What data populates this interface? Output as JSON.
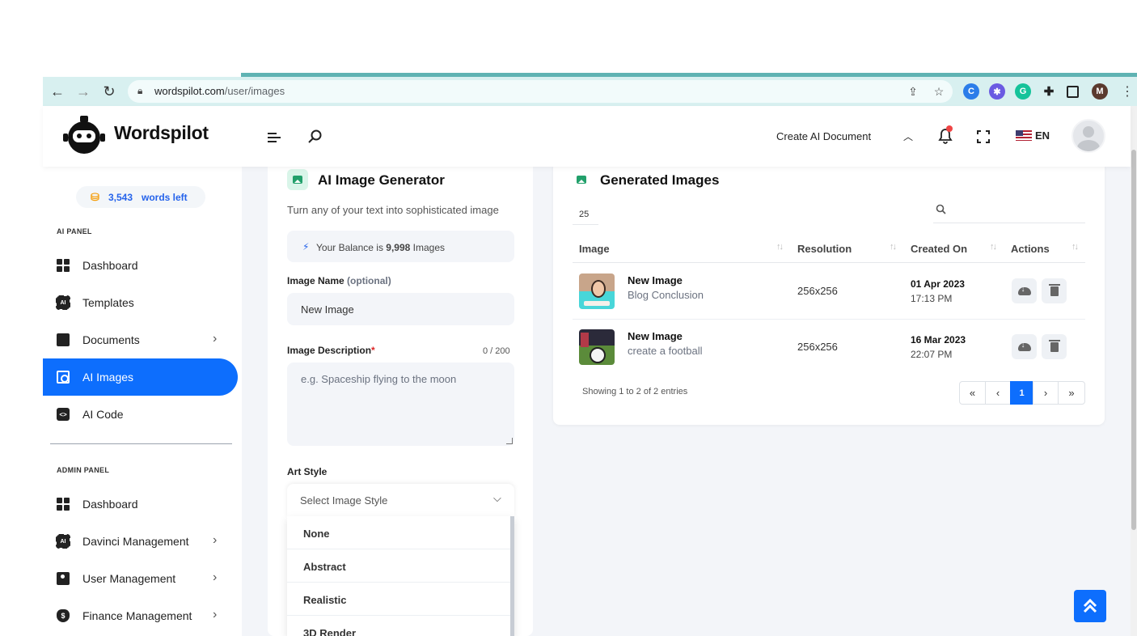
{
  "browser": {
    "url_domain": "wordspilot.com",
    "url_path": "/user/images",
    "profile_initial": "M"
  },
  "header": {
    "brand": "Wordspilot",
    "create_doc": "Create AI Document",
    "language": "EN"
  },
  "sidebar": {
    "words_count": "3,543",
    "words_label": "words left",
    "ai_panel_title": "AI PANEL",
    "ai_items": [
      {
        "label": "Dashboard",
        "icon": "dashboard-icon"
      },
      {
        "label": "Templates",
        "icon": "chip-icon"
      },
      {
        "label": "Documents",
        "icon": "folder-icon"
      },
      {
        "label": "AI Images",
        "icon": "image-scan-icon"
      },
      {
        "label": "AI Code",
        "icon": "code-icon"
      }
    ],
    "admin_panel_title": "ADMIN PANEL",
    "admin_items": [
      {
        "label": "Dashboard",
        "icon": "dashboard-icon"
      },
      {
        "label": "Davinci Management",
        "icon": "chip-icon"
      },
      {
        "label": "User Management",
        "icon": "user-icon"
      },
      {
        "label": "Finance Management",
        "icon": "money-bag-icon"
      }
    ],
    "active_color": "#0d6efd"
  },
  "generator": {
    "title": "AI Image Generator",
    "subtitle": "Turn any of your text into sophisticated image",
    "balance_prefix": "Your Balance is",
    "balance_value": "9,998",
    "balance_suffix": "Images",
    "name_label": "Image Name",
    "name_optional": "(optional)",
    "name_value": "New Image",
    "desc_label": "Image Description",
    "desc_required": "*",
    "desc_counter": "0 / 200",
    "desc_placeholder": "e.g. Spaceship flying to the moon",
    "art_style_label": "Art Style",
    "art_style_placeholder": "Select Image Style",
    "art_style_options": [
      "None",
      "Abstract",
      "Realistic",
      "3D Render"
    ]
  },
  "images": {
    "title": "Generated Images",
    "page_length": "25",
    "columns": [
      "Image",
      "Resolution",
      "Created On",
      "Actions"
    ],
    "rows": [
      {
        "title": "New Image",
        "desc": "Blog Conclusion",
        "resolution": "256x256",
        "date": "01 Apr 2023",
        "time": "17:13 PM"
      },
      {
        "title": "New Image",
        "desc": "create a football",
        "resolution": "256x256",
        "date": "16 Mar 2023",
        "time": "22:07 PM"
      }
    ],
    "showing": "Showing 1 to 2 of 2 entries",
    "pagination": {
      "first": "«",
      "prev": "‹",
      "current": "1",
      "next": "›",
      "last": "»"
    }
  }
}
